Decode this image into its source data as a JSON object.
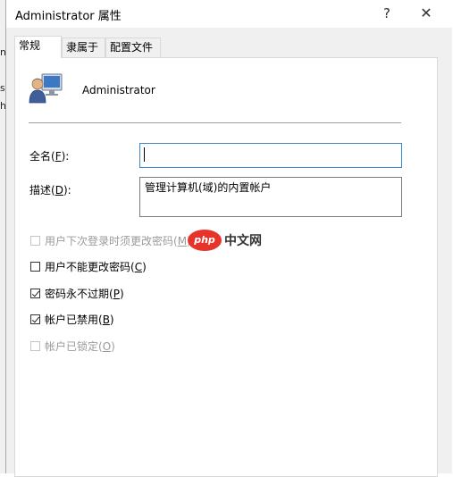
{
  "background_window": {
    "fragments": [
      "ni",
      "s",
      "h"
    ]
  },
  "dialog": {
    "title": "Administrator 属性",
    "help_glyph": "?",
    "close_glyph": "✕"
  },
  "tabs": [
    {
      "label": "常规",
      "active": true
    },
    {
      "label": "隶属于",
      "active": false
    },
    {
      "label": "配置文件",
      "active": false
    }
  ],
  "general": {
    "user_name": "Administrator",
    "full_name": {
      "label": "全名(",
      "mnemonic": "F",
      "suffix": "):",
      "value": ""
    },
    "description": {
      "label": "描述(",
      "mnemonic": "D",
      "suffix": "):",
      "value": "管理计算机(域)的内置帐户"
    },
    "checkboxes": [
      {
        "text": "用户下次登录时须更改密码(",
        "mnemonic": "M",
        "suffix": ")",
        "checked": false,
        "enabled": false
      },
      {
        "text": "用户不能更改密码(",
        "mnemonic": "C",
        "suffix": ")",
        "checked": false,
        "enabled": true
      },
      {
        "text": "密码永不过期(",
        "mnemonic": "P",
        "suffix": ")",
        "checked": true,
        "enabled": true
      },
      {
        "text": "帐户已禁用(",
        "mnemonic": "B",
        "suffix": ")",
        "checked": true,
        "enabled": true
      },
      {
        "text": "帐户已锁定(",
        "mnemonic": "O",
        "suffix": ")",
        "checked": false,
        "enabled": false
      }
    ]
  },
  "watermark": {
    "logo": "php",
    "text": "中文网"
  },
  "colors": {
    "accent_border": "#3a87c8",
    "watermark_red": "#e8332a"
  }
}
